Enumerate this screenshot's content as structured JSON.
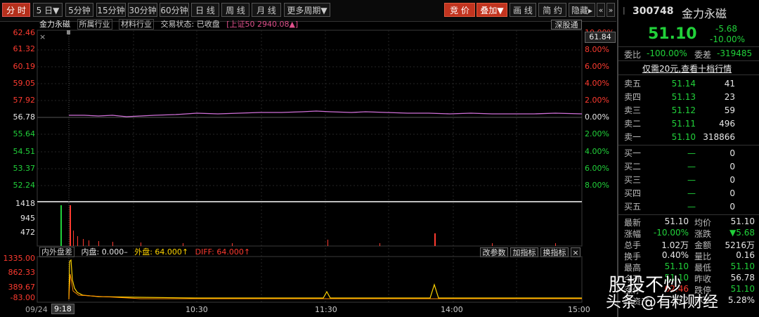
{
  "toolbar": {
    "tabs": [
      "分 时",
      "5 日▼",
      "5分钟",
      "15分钟",
      "30分钟",
      "60分钟",
      "日 线",
      "周 线",
      "月 线",
      "更多周期▼"
    ],
    "right_buttons": [
      "竞 价",
      "叠加▼",
      "画 线",
      "简 约",
      "隐藏▸",
      "«",
      "»"
    ]
  },
  "chart": {
    "stock_name": "金力永磁",
    "info_items": [
      "所属行业",
      "材料行业",
      "交易状态: 已收盘"
    ],
    "index_tag": "[上证50 2940.08▲]",
    "deep_tag": "深股通",
    "close_x": "×",
    "price_labels": [
      "62.46",
      "61.32",
      "60.19",
      "59.05",
      "57.92",
      "56.78",
      "55.64",
      "54.51",
      "53.37",
      "52.24"
    ],
    "pct_labels": [
      "10.00%",
      "8.00%",
      "6.00%",
      "4.00%",
      "2.00%",
      "0.00%",
      "2.00%",
      "4.00%",
      "6.00%",
      "8.00%"
    ],
    "price_tag": "61.84",
    "volume_labels": [
      "1418",
      "945",
      "472"
    ],
    "indicator": {
      "title": "内外盘差",
      "inner": "内盘: 0.000–",
      "outer": "外盘: 64.000↑",
      "diff": "DIFF: 64.000↑",
      "buttons": [
        "改参数",
        "加指标",
        "换指标",
        "×"
      ]
    },
    "indicator_labels": [
      "1335.00",
      "862.33",
      "389.67",
      "-83.00"
    ],
    "time_labels": [
      "09/24",
      "9:18",
      "10:30",
      "11:30",
      "14:00",
      "15:00"
    ]
  },
  "panel": {
    "code": "300748",
    "name": "金力永磁",
    "price": "51.10",
    "change": "-5.68",
    "change_pct": "-10.00%",
    "weibi_label": "委比",
    "weibi": "-100.00%",
    "weicha_label": "委差",
    "weicha": "-319485",
    "promo": "仅需20元,查看十档行情",
    "asks": [
      {
        "label": "卖五",
        "price": "51.14",
        "vol": "41"
      },
      {
        "label": "卖四",
        "price": "51.13",
        "vol": "23"
      },
      {
        "label": "卖三",
        "price": "51.12",
        "vol": "59"
      },
      {
        "label": "卖二",
        "price": "51.11",
        "vol": "496"
      },
      {
        "label": "卖一",
        "price": "51.10",
        "vol": "318866"
      }
    ],
    "bids": [
      {
        "label": "买一",
        "price": "—",
        "vol": "0"
      },
      {
        "label": "买二",
        "price": "—",
        "vol": "0"
      },
      {
        "label": "买三",
        "price": "—",
        "vol": "0"
      },
      {
        "label": "买四",
        "price": "—",
        "vol": "0"
      },
      {
        "label": "买五",
        "price": "—",
        "vol": "0"
      }
    ],
    "stats": [
      {
        "l1": "最新",
        "v1": "51.10",
        "l2": "均价",
        "v2": "51.10"
      },
      {
        "l1": "涨幅",
        "v1": "-10.00%",
        "l2": "涨跌",
        "v2": "▼5.68"
      },
      {
        "l1": "总手",
        "v1": "1.02万",
        "l2": "金额",
        "v2": "5216万"
      },
      {
        "l1": "换手",
        "v1": "0.40%",
        "l2": "量比",
        "v2": "0.16"
      },
      {
        "l1": "最高",
        "v1": "51.10",
        "l2": "最低",
        "v2": "51.10"
      },
      {
        "l1": "今开",
        "v1": "51.10",
        "l2": "昨收",
        "v2": "56.78"
      },
      {
        "l1": "涨停",
        "v1": "62.46",
        "l2": "跌停",
        "v2": "51.10"
      },
      {
        "l1": "净资产",
        "v1": "2.72",
        "l2": "ROE",
        "v2": "5.28%"
      }
    ]
  },
  "watermark": {
    "brand": "头条",
    "handle": "@有料财经",
    "overlay": "股投不炒"
  },
  "colors": {
    "up": "#ff3b30",
    "down": "#21d13a",
    "price_line": "#d070d8",
    "indicator_line": "#ffd400"
  }
}
